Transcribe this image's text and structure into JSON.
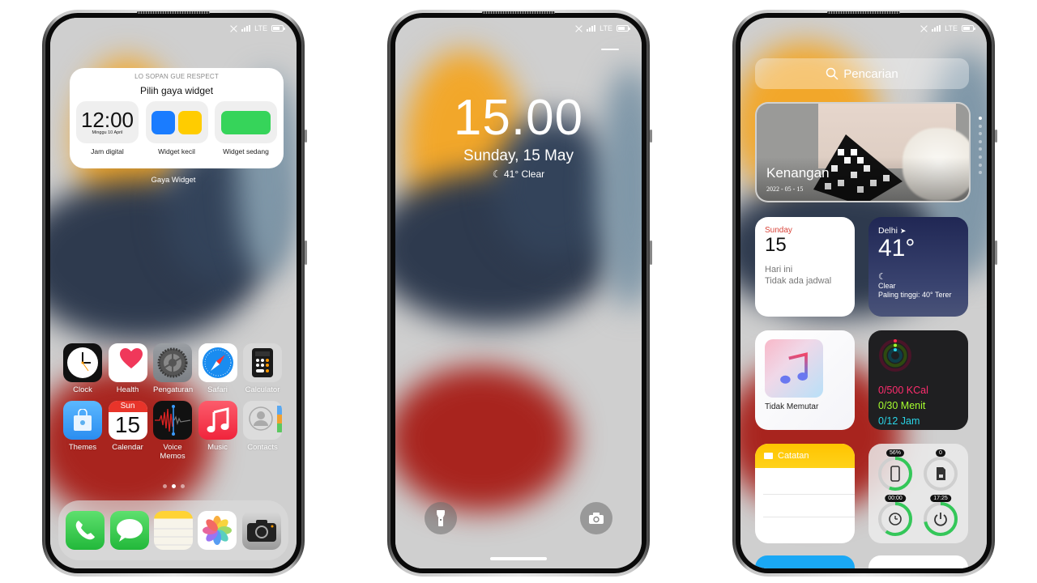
{
  "status_bar": {
    "network": "LTE",
    "icons": [
      "nfc-icon",
      "signal-icon",
      "lte-label",
      "battery-icon"
    ]
  },
  "home_screen": {
    "widget_picker": {
      "subtitle": "LO SOPAN GUE RESPECT",
      "title": "Pilih gaya widget",
      "options": [
        {
          "label": "Jam digital",
          "preview_time": "12:00",
          "preview_date": "Minggu 10 April"
        },
        {
          "label": "Widget kecil",
          "colors": [
            "#1a7cff",
            "#ffcc00"
          ]
        },
        {
          "label": "Widget sedang",
          "colors": [
            "#36d45a"
          ]
        }
      ],
      "caption": "Gaya Widget"
    },
    "apps": [
      {
        "name": "Clock",
        "icon": "clock-icon"
      },
      {
        "name": "Health",
        "icon": "heart-icon"
      },
      {
        "name": "Pengaturan",
        "icon": "settings-gear-icon"
      },
      {
        "name": "Safari",
        "icon": "compass-icon"
      },
      {
        "name": "Calculator",
        "icon": "calculator-icon"
      },
      {
        "name": "Themes",
        "icon": "shopping-bag-icon"
      },
      {
        "name": "Calendar",
        "icon": "calendar-icon",
        "day": "Sun",
        "date": "15"
      },
      {
        "name": "Voice Memos",
        "icon": "waveform-icon"
      },
      {
        "name": "Music",
        "icon": "music-note-icon"
      },
      {
        "name": "Contacts",
        "icon": "contact-icon"
      }
    ],
    "page_dots": {
      "count": 3,
      "active": 2
    },
    "dock": [
      {
        "name": "Phone",
        "icon": "phone-icon"
      },
      {
        "name": "Messages",
        "icon": "message-bubble-icon"
      },
      {
        "name": "Notes",
        "icon": "notes-icon"
      },
      {
        "name": "Photos",
        "icon": "photos-flower-icon"
      },
      {
        "name": "Camera",
        "icon": "camera-icon"
      }
    ]
  },
  "lock_screen": {
    "time": "15.00",
    "date": "Sunday, 15 May",
    "weather": "41° Clear",
    "buttons": [
      {
        "name": "Flashlight",
        "icon": "flashlight-icon"
      },
      {
        "name": "Camera",
        "icon": "camera-icon"
      }
    ]
  },
  "widgets_screen": {
    "search_placeholder": "Pencarian",
    "memories": {
      "title": "Kenangan",
      "date": "2022 - 05 - 15"
    },
    "page_dots": {
      "count": 8,
      "active": 1
    },
    "calendar": {
      "weekday": "Sunday",
      "day": "15",
      "line1": "Hari ini",
      "line2": "Tidak ada jadwal"
    },
    "weather": {
      "city": "Delhi",
      "temp": "41°",
      "condition": "Clear",
      "high": "Paling tinggi:  40° Terer"
    },
    "music": {
      "status": "Tidak Memutar"
    },
    "fitness": {
      "move": "0/500 KCal",
      "exercise": "0/30 Menit",
      "stand": "0/12 Jam",
      "colors": {
        "move": "#ff2d6e",
        "exercise": "#a6ff2e",
        "stand": "#2ad6e8"
      }
    },
    "notes": {
      "title": "Catatan"
    },
    "system": [
      {
        "label": "56%",
        "icon": "phone-outline-icon",
        "progress": 0.56
      },
      {
        "label": "0",
        "icon": "sim-card-icon",
        "progress": 0
      },
      {
        "label": "00:00",
        "icon": "alarm-clock-icon",
        "progress": 0.6
      },
      {
        "label": "17:25",
        "icon": "power-icon",
        "progress": 0.72
      }
    ]
  }
}
